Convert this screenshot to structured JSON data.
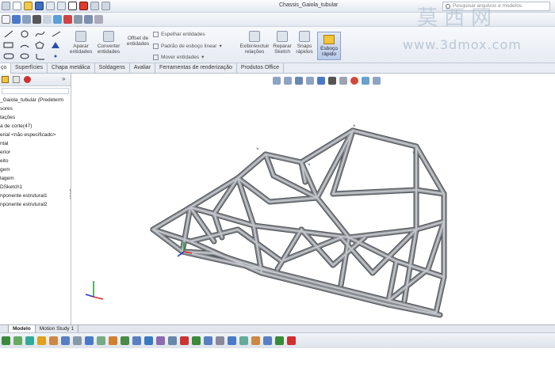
{
  "app": {
    "window_title": "Chassis_Gaiola_tubular",
    "search_placeholder": "Pesquisar arquivos e modelos"
  },
  "watermark": {
    "chinese": "莫西网",
    "url": "www.3dmox.com"
  },
  "ribbon": {
    "apagar_label": "Aparar entidades",
    "converter_label": "Converter entidades",
    "offset_label": "Offset de entidades",
    "espelhar_label": "Espelhar entidades",
    "padrao_label": "Padrão de esboço linear",
    "mover_label": "Mover entidades",
    "exibir_label": "Exibir/excluir relações",
    "reparar_label": "Reparar Sketch",
    "snaps_label": "Snaps rápidos",
    "esboco_label": "Esboço rápido"
  },
  "tabs": [
    "ço",
    "Superfícies",
    "Chapa metálica",
    "Soldagens",
    "Avaliar",
    "Ferramentas de renderização",
    "Produtos Office"
  ],
  "feature_tree": {
    "items": [
      "_Gaiola_tubular  (Predeterm",
      "sores",
      "tações",
      "a de corte(47)",
      "erial <não especificado>",
      "ntal",
      "erior",
      "eito",
      "gem",
      "lagem",
      "DSketch1",
      "nponente estrutural1",
      "nponente estrutural2"
    ]
  },
  "bottom_tabs": [
    "Modelo",
    "Motion Study 1"
  ],
  "colors": {
    "tube": "#8a8e93",
    "tube_dark": "#4c5055",
    "tube_light": "#c3c7cc",
    "axis_x": "#d22",
    "axis_y": "#1a9a2a",
    "axis_z": "#2233cc"
  }
}
